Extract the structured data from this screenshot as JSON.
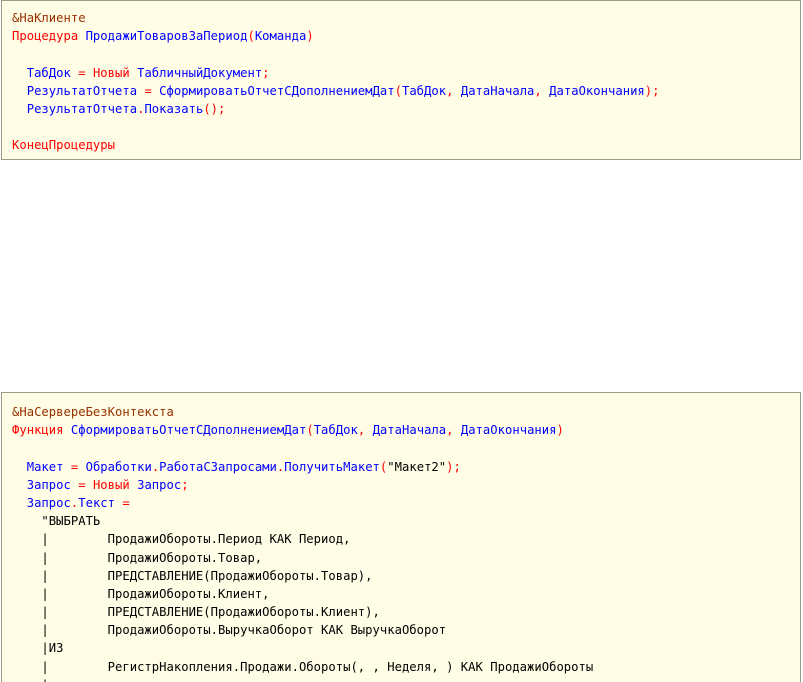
{
  "top_panel": {
    "lines": [
      [
        {
          "t": "&НаКлиенте",
          "c": "dir"
        }
      ],
      [
        {
          "t": "Процедура ",
          "c": "kw"
        },
        {
          "t": "ПродажиТоваровЗаПериод",
          "c": "id"
        },
        {
          "t": "(",
          "c": "op"
        },
        {
          "t": "Команда",
          "c": "id"
        },
        {
          "t": ")",
          "c": "op"
        }
      ],
      [
        {
          "t": "",
          "c": "id"
        }
      ],
      [
        {
          "t": "  ТабДок ",
          "c": "id"
        },
        {
          "t": "= ",
          "c": "op"
        },
        {
          "t": "Новый ",
          "c": "kw"
        },
        {
          "t": "ТабличныйДокумент",
          "c": "id"
        },
        {
          "t": ";",
          "c": "op"
        }
      ],
      [
        {
          "t": "  РезультатОтчета ",
          "c": "id"
        },
        {
          "t": "= ",
          "c": "op"
        },
        {
          "t": "СформироватьОтчетСДополнениемДат",
          "c": "id"
        },
        {
          "t": "(",
          "c": "op"
        },
        {
          "t": "ТабДок",
          "c": "id"
        },
        {
          "t": ", ",
          "c": "op"
        },
        {
          "t": "ДатаНачала",
          "c": "id"
        },
        {
          "t": ", ",
          "c": "op"
        },
        {
          "t": "ДатаОкончания",
          "c": "id"
        },
        {
          "t": ");",
          "c": "op"
        }
      ],
      [
        {
          "t": "  РезультатОтчета",
          "c": "id"
        },
        {
          "t": ".",
          "c": "op"
        },
        {
          "t": "Показать",
          "c": "id"
        },
        {
          "t": "();",
          "c": "op"
        }
      ],
      [
        {
          "t": "",
          "c": "id"
        }
      ],
      [
        {
          "t": "КонецПроцедуры",
          "c": "kw"
        }
      ]
    ]
  },
  "bottom_panel": {
    "lines": [
      [
        {
          "t": "&НаСервереБезКонтекста",
          "c": "dir"
        }
      ],
      [
        {
          "t": "Функция ",
          "c": "kw"
        },
        {
          "t": "СформироватьОтчетСДополнениемДат",
          "c": "id"
        },
        {
          "t": "(",
          "c": "op"
        },
        {
          "t": "ТабДок",
          "c": "id"
        },
        {
          "t": ", ",
          "c": "op"
        },
        {
          "t": "ДатаНачала",
          "c": "id"
        },
        {
          "t": ", ",
          "c": "op"
        },
        {
          "t": "ДатаОкончания",
          "c": "id"
        },
        {
          "t": ")",
          "c": "op"
        }
      ],
      [
        {
          "t": "",
          "c": "id"
        }
      ],
      [
        {
          "t": "  Макет ",
          "c": "id"
        },
        {
          "t": "= ",
          "c": "op"
        },
        {
          "t": "Обработки",
          "c": "id"
        },
        {
          "t": ".",
          "c": "op"
        },
        {
          "t": "РаботаСЗапросами",
          "c": "id"
        },
        {
          "t": ".",
          "c": "op"
        },
        {
          "t": "ПолучитьМакет",
          "c": "id"
        },
        {
          "t": "(",
          "c": "op"
        },
        {
          "t": "\"Макет2\"",
          "c": "str"
        },
        {
          "t": ");",
          "c": "op"
        }
      ],
      [
        {
          "t": "  Запрос ",
          "c": "id"
        },
        {
          "t": "= ",
          "c": "op"
        },
        {
          "t": "Новый ",
          "c": "kw"
        },
        {
          "t": "Запрос",
          "c": "id"
        },
        {
          "t": ";",
          "c": "op"
        }
      ],
      [
        {
          "t": "  Запрос",
          "c": "id"
        },
        {
          "t": ".",
          "c": "op"
        },
        {
          "t": "Текст ",
          "c": "id"
        },
        {
          "t": "=",
          "c": "op"
        }
      ],
      [
        {
          "t": "    \"ВЫБРАТЬ",
          "c": "str"
        }
      ],
      [
        {
          "t": "    |        ПродажиОбороты.Период КАК Период,",
          "c": "str"
        }
      ],
      [
        {
          "t": "    |        ПродажиОбороты.Товар,",
          "c": "str"
        }
      ],
      [
        {
          "t": "    |        ПРЕДСТАВЛЕНИЕ(ПродажиОбороты.Товар),",
          "c": "str"
        }
      ],
      [
        {
          "t": "    |        ПродажиОбороты.Клиент,",
          "c": "str"
        }
      ],
      [
        {
          "t": "    |        ПРЕДСТАВЛЕНИЕ(ПродажиОбороты.Клиент),",
          "c": "str"
        }
      ],
      [
        {
          "t": "    |        ПродажиОбороты.ВыручкаОборот КАК ВыручкаОборот",
          "c": "str"
        }
      ],
      [
        {
          "t": "    |ИЗ",
          "c": "str"
        }
      ],
      [
        {
          "t": "    |        РегистрНакопления.Продажи.Обороты(, , Неделя, ) КАК ПродажиОбороты",
          "c": "str"
        }
      ],
      [
        {
          "t": "    |",
          "c": "str"
        }
      ]
    ]
  }
}
